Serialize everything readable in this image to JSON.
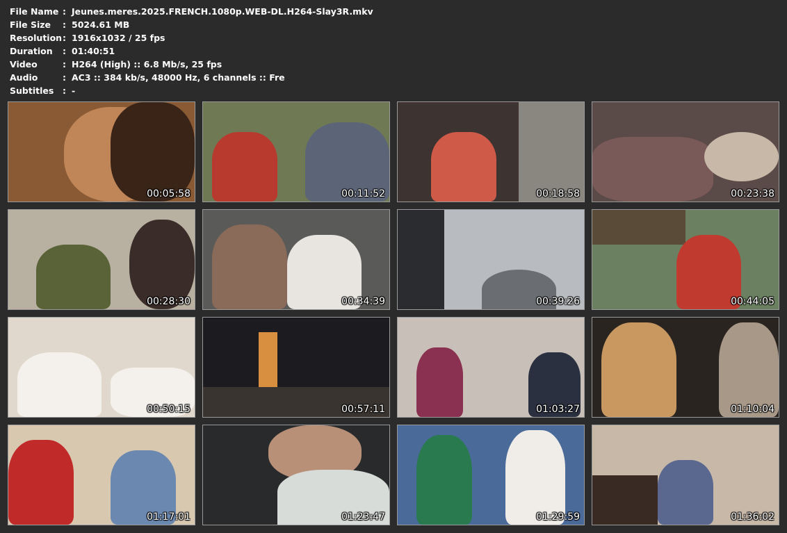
{
  "info": [
    {
      "label": "File Name",
      "sep": ":",
      "value": "Jeunes.meres.2025.FRENCH.1080p.WEB-DL.H264-Slay3R.mkv"
    },
    {
      "label": "File Size",
      "sep": ":",
      "value": "5024.61 MB"
    },
    {
      "label": "Resolution",
      "sep": ":",
      "value": "1916x1032 / 25 fps"
    },
    {
      "label": "Duration",
      "sep": ":",
      "value": "01:40:51"
    },
    {
      "label": "Video",
      "sep": ":",
      "value": "H264 (High) :: 6.8 Mb/s, 25 fps"
    },
    {
      "label": "Audio",
      "sep": ":",
      "value": "AC3 :: 384 kb/s, 48000 Hz, 6 channels :: Fre"
    },
    {
      "label": "Subtitles",
      "sep": ":",
      "value": "-"
    }
  ],
  "thumbnails": [
    {
      "timestamp": "00:05:58",
      "colors": [
        "#8a5a35",
        "#c08658",
        "#3a2418"
      ]
    },
    {
      "timestamp": "00:11:52",
      "colors": [
        "#6f7a55",
        "#b8392e",
        "#5c6478"
      ]
    },
    {
      "timestamp": "00:18:58",
      "colors": [
        "#3d3432",
        "#d05a48",
        "#8a8780"
      ]
    },
    {
      "timestamp": "00:23:38",
      "colors": [
        "#5a4a48",
        "#c7b8a8",
        "#7a5a58"
      ]
    },
    {
      "timestamp": "00:28:30",
      "colors": [
        "#b8b0a0",
        "#5a6238",
        "#3a2c28"
      ]
    },
    {
      "timestamp": "00:34:39",
      "colors": [
        "#5a5a58",
        "#e8e4e0",
        "#8a6a58"
      ]
    },
    {
      "timestamp": "00:39:26",
      "colors": [
        "#b8bcc0",
        "#2a2c30",
        "#6a6e72"
      ]
    },
    {
      "timestamp": "00:44:05",
      "colors": [
        "#6a8060",
        "#c03a30",
        "#5a4a38"
      ]
    },
    {
      "timestamp": "00:50:15",
      "colors": [
        "#e0d8cc",
        "#f4f0ec",
        "#c8a068"
      ]
    },
    {
      "timestamp": "00:57:11",
      "colors": [
        "#1c1c20",
        "#d89040",
        "#3a3430"
      ]
    },
    {
      "timestamp": "01:03:27",
      "colors": [
        "#c8c0b8",
        "#8a3050",
        "#2a3040"
      ]
    },
    {
      "timestamp": "01:10:04",
      "colors": [
        "#2a2420",
        "#c89860",
        "#a89888"
      ]
    },
    {
      "timestamp": "01:17:01",
      "colors": [
        "#d8c8b0",
        "#c02a28",
        "#6a88b0"
      ]
    },
    {
      "timestamp": "01:23:47",
      "colors": [
        "#282a2c",
        "#b89078",
        "#d8dcd8"
      ]
    },
    {
      "timestamp": "01:29:59",
      "colors": [
        "#4a6a9a",
        "#2a7a50",
        "#f0ece8"
      ]
    },
    {
      "timestamp": "01:36:02",
      "colors": [
        "#c8b8a8",
        "#3a2a24",
        "#5a6890"
      ]
    }
  ]
}
